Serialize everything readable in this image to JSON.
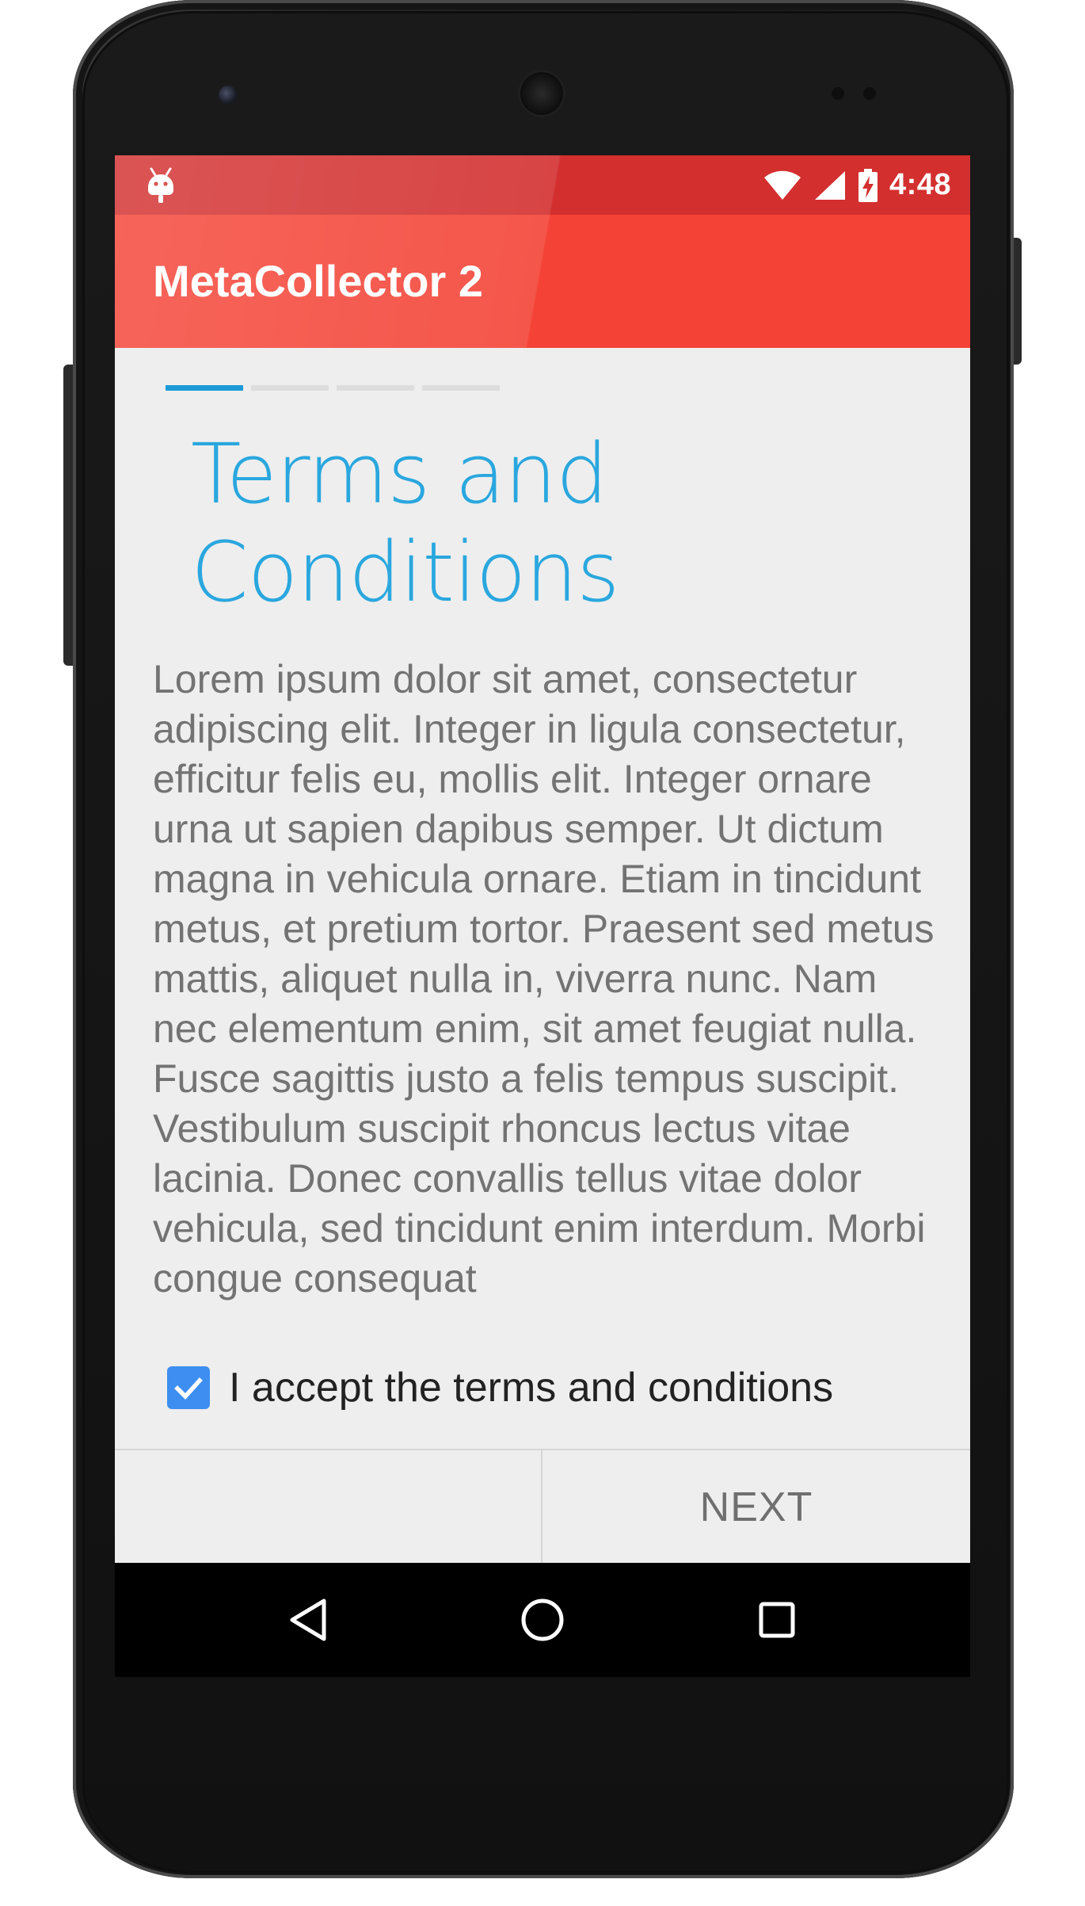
{
  "status_bar": {
    "time": "4:48",
    "icons": [
      "android-debug-icon",
      "wifi-icon",
      "cell-signal-icon",
      "battery-charging-icon"
    ]
  },
  "app_bar": {
    "title": "MetaCollector 2",
    "color": "#f44336",
    "status_color": "#d32f2f"
  },
  "wizard": {
    "steps": [
      {
        "state": "active"
      },
      {
        "state": "inactive"
      },
      {
        "state": "inactive"
      },
      {
        "state": "inactive"
      }
    ],
    "current_step": 1,
    "step_count": 4,
    "accent_color": "#1e9ad6"
  },
  "page": {
    "title_line1": "Terms and",
    "title_line2": "Conditions",
    "body": "Lorem ipsum dolor sit amet, consectetur adipiscing elit. Integer in ligula consectetur, efficitur felis eu, mollis elit. Integer ornare urna ut sapien dapibus semper. Ut dictum magna in vehicula ornare. Etiam in tincidunt metus, et pretium tortor. Praesent sed metus mattis, aliquet nulla in, viverra nunc. Nam nec elementum enim, sit amet feugiat nulla. Fusce sagittis justo a felis tempus suscipit. Vestibulum suscipit rhoncus lectus vitae lacinia. Donec convallis tellus vitae dolor vehicula, sed tincidunt enim interdum. Morbi congue consequat"
  },
  "accept": {
    "label": "I accept the terms and conditions",
    "checked": true,
    "checkbox_color": "#3d8ef0"
  },
  "footer": {
    "next_label": "NEXT"
  },
  "nav_bar": {
    "buttons": [
      "back-icon",
      "home-icon",
      "recents-icon"
    ]
  }
}
